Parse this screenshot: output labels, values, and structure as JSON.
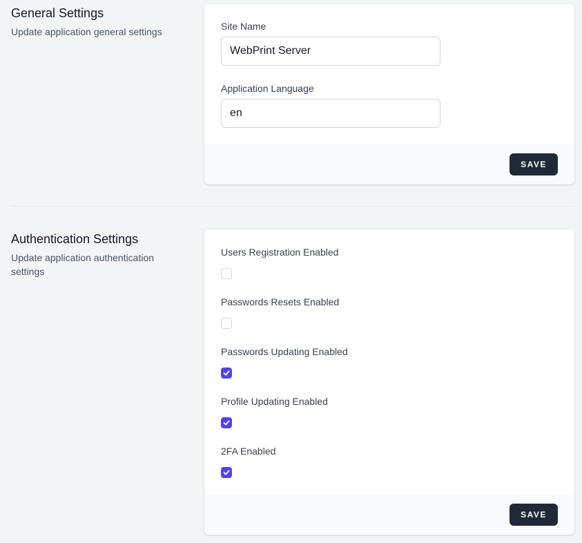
{
  "general": {
    "title": "General Settings",
    "description": "Update application general settings",
    "fields": [
      {
        "label": "Site Name",
        "value": "WebPrint Server"
      },
      {
        "label": "Application Language",
        "value": "en"
      }
    ],
    "save_label": "SAVE"
  },
  "auth": {
    "title": "Authentication Settings",
    "description": "Update application authentication settings",
    "options": [
      {
        "label": "Users Registration Enabled",
        "checked": false
      },
      {
        "label": "Passwords Resets Enabled",
        "checked": false
      },
      {
        "label": "Passwords Updating Enabled",
        "checked": true
      },
      {
        "label": "Profile Updating Enabled",
        "checked": true
      },
      {
        "label": "2FA Enabled",
        "checked": true
      }
    ],
    "save_label": "SAVE"
  },
  "colors": {
    "background": "#f3f4f6",
    "card": "#ffffff",
    "footer": "#f9fafb",
    "button": "#1f2937",
    "checkbox_checked": "#4f46e5"
  }
}
